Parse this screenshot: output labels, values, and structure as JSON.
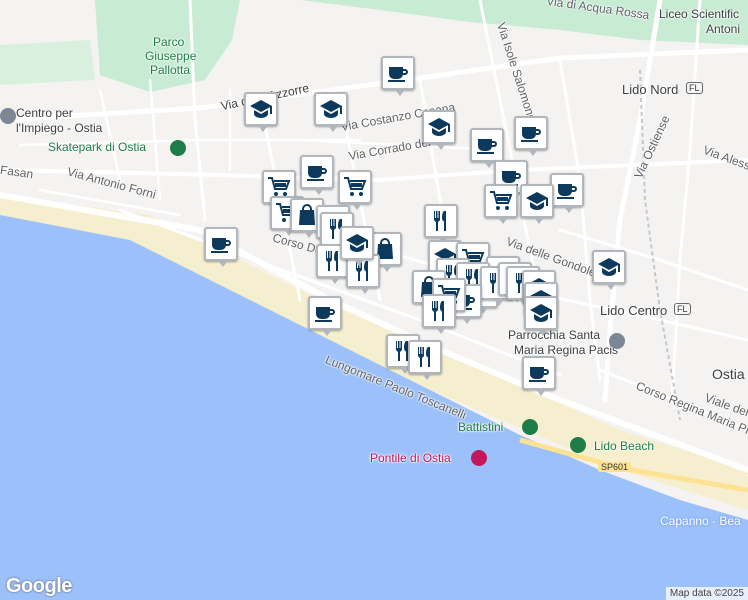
{
  "map": {
    "colors": {
      "sea": "#9cc0f9",
      "land": "#f4f3f1",
      "park": "#c8ebd3",
      "beach": "#f6efcf",
      "road": "#ffffff",
      "pin_icon": "#0d3a5c",
      "pin_border": "#b0b6bc"
    },
    "labels": {
      "acqua_rossa": "Via di Acqua Rossa",
      "liceo": "Liceo Scientific",
      "antonio": "Antoni",
      "parco1": "Parco",
      "parco2": "Giuseppe",
      "parco3": "Pallotta",
      "via_azzorre": "Via delle Azzorre",
      "isole_salomone": "Via Isole Salomone",
      "lido_nord": "Lido Nord",
      "lido_nord_badge": "FL",
      "centro1": "Centro per",
      "centro2": "l'Impiego - Ostia",
      "costanzo": "Via Costanzo Casana",
      "corrado": "Via Corrado del",
      "ostiense": "Via Ostiense",
      "alessandro": "Via Alessa",
      "skatepark": "Skatepark di Ostia",
      "fasan": "Fasan",
      "forni": "Via Antonio Forni",
      "gondole": "Via delle Gondole",
      "corso_duca": "Corso Du",
      "lido_centro": "Lido Centro",
      "lido_centro_badge": "FL",
      "parrocchia1": "Parrocchia Santa",
      "parrocchia2": "Maria Regina Pacis",
      "lungomare": "Lungomare Paolo Toscanelli",
      "ostia": "Ostia",
      "viale": "Viale del",
      "corso_regina": "Corso Regina Maria Pia",
      "battistini": "Battistini",
      "lido_beach": "Lido Beach",
      "pontile": "Pontile di Ostia",
      "sp601": "SP601",
      "capanno": "Capanno - Bea"
    },
    "pins": [
      {
        "type": "cafe"
      },
      {
        "type": "school"
      },
      {
        "type": "school"
      },
      {
        "type": "school"
      },
      {
        "type": "cafe"
      },
      {
        "type": "cafe"
      },
      {
        "type": "cafe"
      },
      {
        "type": "shop"
      },
      {
        "type": "cafe"
      },
      {
        "type": "shop"
      },
      {
        "type": "shop"
      },
      {
        "type": "shop"
      },
      {
        "type": "shopping"
      },
      {
        "type": "shop"
      },
      {
        "type": "restaurant"
      },
      {
        "type": "cafe"
      },
      {
        "type": "restaurant"
      },
      {
        "type": "school"
      },
      {
        "type": "shopping"
      },
      {
        "type": "restaurant"
      },
      {
        "type": "restaurant"
      },
      {
        "type": "school"
      },
      {
        "type": "school"
      },
      {
        "type": "cafe"
      },
      {
        "type": "cafe"
      },
      {
        "type": "school"
      },
      {
        "type": "shop"
      },
      {
        "type": "school"
      },
      {
        "type": "cafe"
      },
      {
        "type": "restaurant"
      },
      {
        "type": "restaurant"
      },
      {
        "type": "restaurant"
      },
      {
        "type": "restaurant"
      },
      {
        "type": "restaurant"
      },
      {
        "type": "shopping"
      },
      {
        "type": "cafe"
      },
      {
        "type": "shop"
      },
      {
        "type": "school"
      },
      {
        "type": "school"
      },
      {
        "type": "school"
      },
      {
        "type": "restaurant"
      },
      {
        "type": "restaurant"
      },
      {
        "type": "restaurant"
      },
      {
        "type": "cafe"
      }
    ],
    "google": "Google",
    "attribution": "Map data ©2025"
  }
}
